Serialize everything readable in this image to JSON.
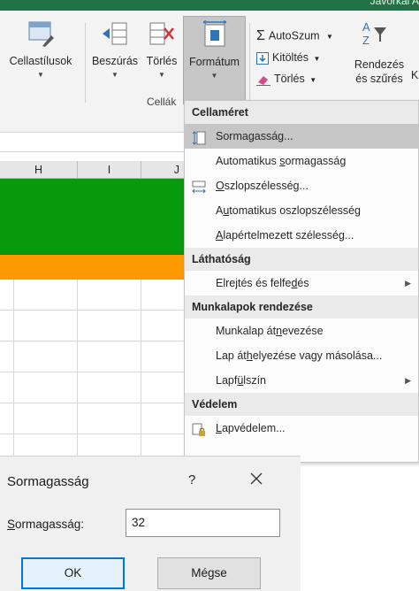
{
  "titlebar": {
    "user": "Javorkai A"
  },
  "ribbon": {
    "cellstyles": "Cellastílusok",
    "insert": "Beszúrás",
    "delete": "Törlés",
    "format": "Formátum",
    "cells_group": "Cellák",
    "autosum": "AutoSzum",
    "fill": "Kitöltés",
    "clear": "Törlés",
    "sort_line1": "Rendezés",
    "sort_line2": "és szűrés",
    "cut_k": "K"
  },
  "sheet": {
    "columns": [
      "H",
      "I",
      "J"
    ],
    "colors": {
      "green_row": "#069a0c",
      "orange_row": "#fd9900"
    }
  },
  "menu": {
    "sections": [
      {
        "header": "Cellaméret",
        "items": [
          {
            "pre": "Sorma",
            "ul": "g",
            "post": "asság...",
            "icon": "row-height-icon",
            "highlight": true
          },
          {
            "pre": "Automatikus ",
            "ul": "s",
            "post": "ormagasság",
            "icon": ""
          },
          {
            "pre": "",
            "ul": "O",
            "post": "szlopszélesség...",
            "icon": "column-width-icon"
          },
          {
            "pre": "A",
            "ul": "u",
            "post": "tomatikus oszlopszélesség",
            "icon": ""
          },
          {
            "pre": "",
            "ul": "A",
            "post": "lapértelmezett szélesség...",
            "icon": ""
          }
        ]
      },
      {
        "header": "Láthatóság",
        "items": [
          {
            "pre": "Elrejtés és felfe",
            "ul": "d",
            "post": "és",
            "icon": "",
            "submenu": true
          }
        ]
      },
      {
        "header": "Munkalapok rendezése",
        "items": [
          {
            "pre": "Munkalap át",
            "ul": "n",
            "post": "evezése",
            "icon": ""
          },
          {
            "pre": "Lap át",
            "ul": "h",
            "post": "elyezése vagy másolása...",
            "icon": ""
          },
          {
            "pre": "Lapf",
            "ul": "ü",
            "post": "lszín",
            "icon": "",
            "submenu": true
          }
        ]
      },
      {
        "header": "Védelem",
        "items": [
          {
            "pre": "",
            "ul": "L",
            "post": "apvédelem...",
            "icon": "protect-sheet-icon"
          }
        ]
      }
    ]
  },
  "dialog": {
    "title": "Sormagasság",
    "help": "?",
    "label_ul": "S",
    "label_rest": "ormagasság:",
    "value": "32",
    "ok": "OK",
    "cancel": "Mégse"
  }
}
